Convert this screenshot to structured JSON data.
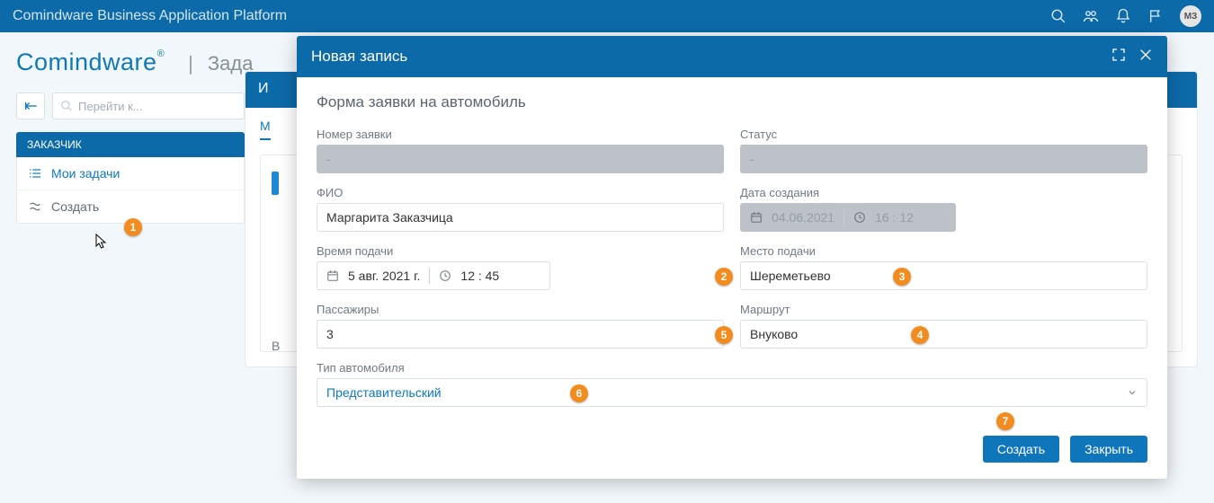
{
  "topbar": {
    "title": "Comindware Business Application Platform",
    "avatar_initials": "МЗ"
  },
  "sidebar": {
    "brand": "Comindware",
    "brand_sub": "Зада",
    "search_placeholder": "Перейти к...",
    "section_label": "ЗАКАЗЧИК",
    "items": [
      {
        "label": "Мои задачи"
      },
      {
        "label": "Создать"
      }
    ]
  },
  "main": {
    "strip_initial": "И",
    "tab_letter": "М",
    "bottom_letter": "В"
  },
  "modal": {
    "title": "Новая запись",
    "form_title": "Форма заявки на автомобиль",
    "fields": {
      "request_no": {
        "label": "Номер заявки",
        "value": "-"
      },
      "status": {
        "label": "Статус",
        "value": "-"
      },
      "fio": {
        "label": "ФИО",
        "value": "Маргарита Заказчица"
      },
      "created": {
        "label": "Дата создания",
        "date": "04.06.2021",
        "time": "16 : 12"
      },
      "supply_time": {
        "label": "Время подачи",
        "date": "5 авг. 2021 г.",
        "time": "12 : 45"
      },
      "supply_place": {
        "label": "Место подачи",
        "value": "Шереметьево"
      },
      "passengers": {
        "label": "Пассажиры",
        "value": "3"
      },
      "route": {
        "label": "Маршрут",
        "value": "Внуково"
      },
      "car_type": {
        "label": "Тип автомобиля",
        "value": "Представительский"
      }
    },
    "buttons": {
      "submit": "Создать",
      "close": "Закрыть"
    }
  },
  "callouts": {
    "1": "1",
    "2": "2",
    "3": "3",
    "4": "4",
    "5": "5",
    "6": "6",
    "7": "7"
  }
}
